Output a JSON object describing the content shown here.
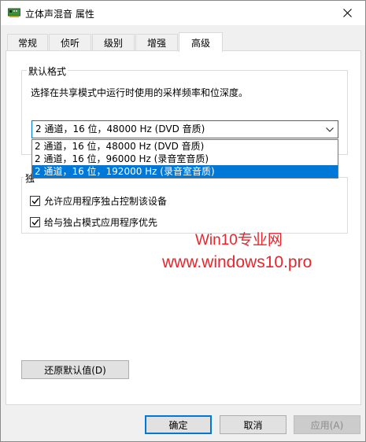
{
  "window": {
    "title": "立体声混音 属性",
    "close_icon": "close-icon"
  },
  "tabs": [
    {
      "label": "常规"
    },
    {
      "label": "侦听"
    },
    {
      "label": "级别"
    },
    {
      "label": "增强"
    },
    {
      "label": "高级",
      "active": true
    }
  ],
  "default_format": {
    "group_label": "默认格式",
    "description": "选择在共享模式中运行时使用的采样频率和位深度。",
    "selected_value": "2 通道，16 位，48000 Hz (DVD 音质)",
    "options": [
      "2 通道，16 位，48000 Hz (DVD 音质)",
      "2 通道，16 位，96000 Hz (录音室音质)",
      "2 通道，16 位，192000 Hz (录音室音质)"
    ],
    "highlighted_index": 2
  },
  "exclusive_mode": {
    "group_label_partial": "独",
    "allow_exclusive": {
      "label": "允许应用程序独占控制该设备",
      "checked": true
    },
    "give_priority": {
      "label": "给与独占模式应用程序优先",
      "checked": true
    }
  },
  "watermark": {
    "line1": "Win10专业网",
    "line2": "www.windows10.pro"
  },
  "buttons": {
    "restore_defaults": "还原默认值(D)",
    "ok": "确定",
    "cancel": "取消",
    "apply": "应用(A)"
  },
  "colors": {
    "accent": "#0078d7",
    "watermark": "#e8252b"
  }
}
